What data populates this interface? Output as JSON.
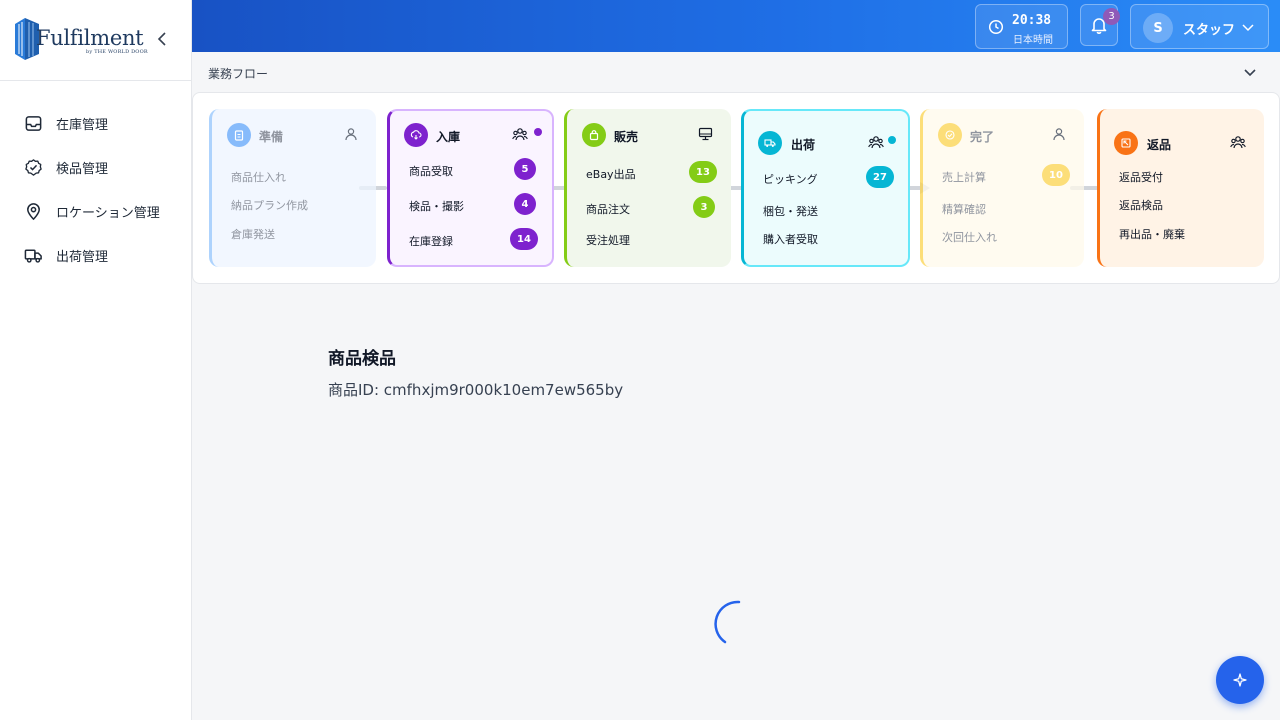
{
  "brand": {
    "name": "Fulfilment",
    "tagline": "by THE WORLD DOOR"
  },
  "sidebar": {
    "items": [
      {
        "label": "在庫管理",
        "icon": "inbox-icon"
      },
      {
        "label": "検品管理",
        "icon": "check-circle-icon"
      },
      {
        "label": "ロケーション管理",
        "icon": "map-pin-icon"
      },
      {
        "label": "出荷管理",
        "icon": "truck-icon"
      }
    ]
  },
  "header": {
    "time": "20:38",
    "timezone": "日本時間",
    "notification_count": "3",
    "user_initial": "S",
    "user_name": "スタッフ"
  },
  "workflow": {
    "title": "業務フロー",
    "stages": [
      {
        "title": "準備",
        "accent": "#93c5fd",
        "items": [
          {
            "label": "商品仕入れ"
          },
          {
            "label": "納品プラン作成"
          },
          {
            "label": "倉庫発送"
          }
        ]
      },
      {
        "title": "入庫",
        "accent": "#7e22ce",
        "items": [
          {
            "label": "商品受取",
            "count": "5"
          },
          {
            "label": "検品・撮影",
            "count": "4"
          },
          {
            "label": "在庫登録",
            "count": "14"
          }
        ]
      },
      {
        "title": "販売",
        "accent": "#84cc16",
        "items": [
          {
            "label": "eBay出品",
            "count": "13"
          },
          {
            "label": "商品注文",
            "count": "3"
          },
          {
            "label": "受注処理"
          }
        ]
      },
      {
        "title": "出荷",
        "accent": "#06b6d4",
        "items": [
          {
            "label": "ピッキング",
            "count": "27"
          },
          {
            "label": "梱包・発送"
          },
          {
            "label": "購入者受取"
          }
        ]
      },
      {
        "title": "完了",
        "accent": "#fcd34d",
        "items": [
          {
            "label": "売上計算",
            "count": "10"
          },
          {
            "label": "精算確認"
          },
          {
            "label": "次回仕入れ"
          }
        ]
      },
      {
        "title": "返品",
        "accent": "#f97316",
        "items": [
          {
            "label": "返品受付"
          },
          {
            "label": "返品検品"
          },
          {
            "label": "再出品・廃棄"
          }
        ]
      }
    ]
  },
  "main": {
    "title": "商品検品",
    "product_id": "商品ID: cmfhxjm9r000k10em7ew565by"
  }
}
